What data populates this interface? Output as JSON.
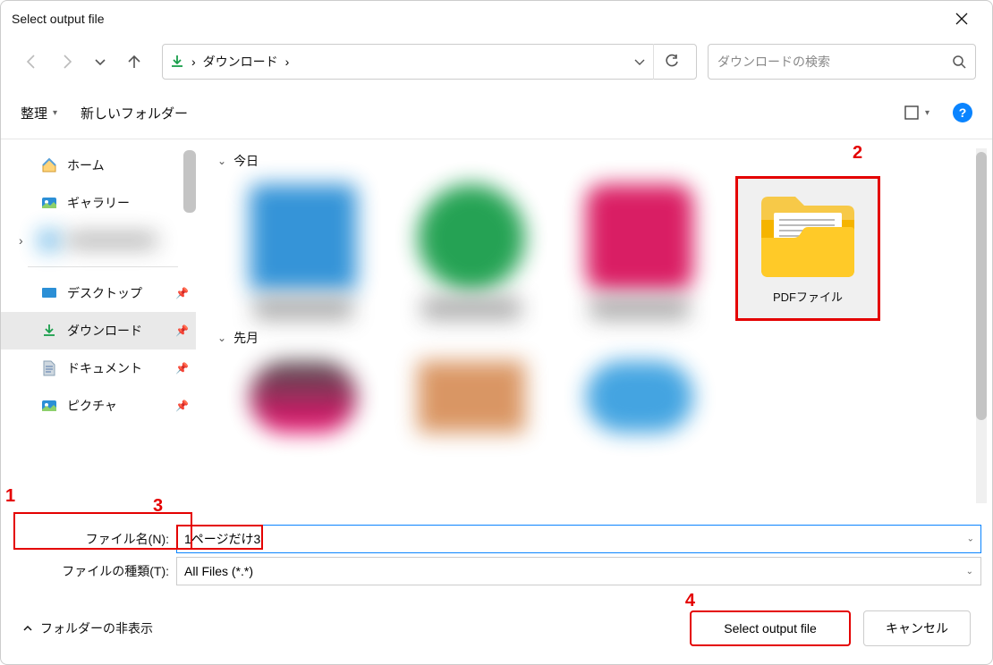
{
  "title": "Select output file",
  "breadcrumb": {
    "location": "ダウンロード"
  },
  "search": {
    "placeholder": "ダウンロードの検索"
  },
  "toolbar": {
    "organize": "整理",
    "newfolder": "新しいフォルダー"
  },
  "sidebar": {
    "home": "ホーム",
    "gallery": "ギャラリー",
    "blurred": " ",
    "desktop": "デスクトップ",
    "downloads": "ダウンロード",
    "documents": "ドキュメント",
    "pictures": "ピクチャ"
  },
  "groups": {
    "today": "今日",
    "lastmonth": "先月"
  },
  "file": {
    "folder_pdf": "PDFファイル"
  },
  "filename": {
    "label": "ファイル名(N):",
    "value": "1ページだけ3"
  },
  "filetype": {
    "label": "ファイルの種類(T):",
    "value": "All Files (*.*)"
  },
  "hidefolders": "フォルダーの非表示",
  "buttons": {
    "save": "Select output file",
    "cancel": "キャンセル"
  },
  "annotations": {
    "n1": "1",
    "n2": "2",
    "n3": "3",
    "n4": "4"
  }
}
